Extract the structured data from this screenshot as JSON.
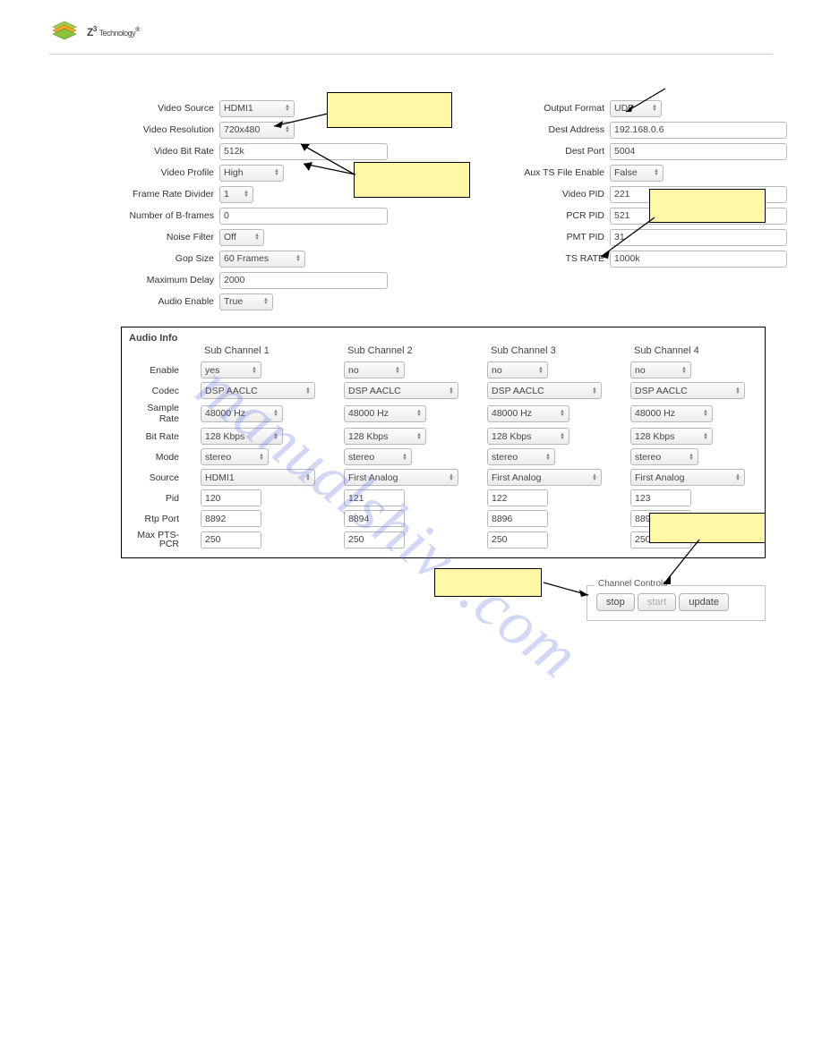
{
  "header": {
    "brand_z": "Z",
    "brand_sup": "3",
    "brand_tech": "Technology",
    "brand_reg": "®"
  },
  "watermark": "manualshive.com",
  "left": {
    "video_source": {
      "label": "Video Source",
      "value": "HDMI1"
    },
    "video_resolution": {
      "label": "Video Resolution",
      "value": "720x480"
    },
    "video_bitrate": {
      "label": "Video Bit Rate",
      "value": "512k"
    },
    "video_profile": {
      "label": "Video Profile",
      "value": "High"
    },
    "frame_rate_divider": {
      "label": "Frame Rate Divider",
      "value": "1"
    },
    "num_bframes": {
      "label": "Number of B-frames",
      "value": "0"
    },
    "noise_filter": {
      "label": "Noise Filter",
      "value": "Off"
    },
    "gop_size": {
      "label": "Gop Size",
      "value": "60 Frames"
    },
    "max_delay": {
      "label": "Maximum Delay",
      "value": "2000"
    },
    "audio_enable": {
      "label": "Audio Enable",
      "value": "True"
    }
  },
  "right": {
    "output_format": {
      "label": "Output Format",
      "value": "UDP"
    },
    "dest_address": {
      "label": "Dest Address",
      "value": "192.168.0.6"
    },
    "dest_port": {
      "label": "Dest Port",
      "value": "5004"
    },
    "aux_ts_enable": {
      "label": "Aux TS File Enable",
      "value": "False"
    },
    "video_pid": {
      "label": "Video PID",
      "value": "221"
    },
    "pcr_pid": {
      "label": "PCR PID",
      "value": "521"
    },
    "pmt_pid": {
      "label": "PMT PID",
      "value": "31"
    },
    "ts_rate": {
      "label": "TS RATE",
      "value": "1000k"
    }
  },
  "audio": {
    "title": "Audio Info",
    "rows": {
      "enable": "Enable",
      "codec": "Codec",
      "sample_rate": "Sample Rate",
      "bitrate": "Bit Rate",
      "mode": "Mode",
      "source": "Source",
      "pid": "Pid",
      "rtp_port": "Rtp Port",
      "max_ptspcr": "Max PTS-PCR"
    },
    "sub": [
      {
        "name": "Sub Channel 1",
        "enable": "yes",
        "codec": "DSP AACLC",
        "sample_rate": "48000 Hz",
        "bitrate": "128 Kbps",
        "mode": "stereo",
        "source": "HDMI1",
        "pid": "120",
        "rtp_port": "8892",
        "max_ptspcr": "250"
      },
      {
        "name": "Sub Channel 2",
        "enable": "no",
        "codec": "DSP AACLC",
        "sample_rate": "48000 Hz",
        "bitrate": "128 Kbps",
        "mode": "stereo",
        "source": "First Analog",
        "pid": "121",
        "rtp_port": "8894",
        "max_ptspcr": "250"
      },
      {
        "name": "Sub Channel 3",
        "enable": "no",
        "codec": "DSP AACLC",
        "sample_rate": "48000 Hz",
        "bitrate": "128 Kbps",
        "mode": "stereo",
        "source": "First Analog",
        "pid": "122",
        "rtp_port": "8896",
        "max_ptspcr": "250"
      },
      {
        "name": "Sub Channel 4",
        "enable": "no",
        "codec": "DSP AACLC",
        "sample_rate": "48000 Hz",
        "bitrate": "128 Kbps",
        "mode": "stereo",
        "source": "First Analog",
        "pid": "123",
        "rtp_port": "8898",
        "max_ptspcr": "250"
      }
    ]
  },
  "controls": {
    "legend": "Channel Controls",
    "stop": "stop",
    "start": "start",
    "update": "update"
  }
}
